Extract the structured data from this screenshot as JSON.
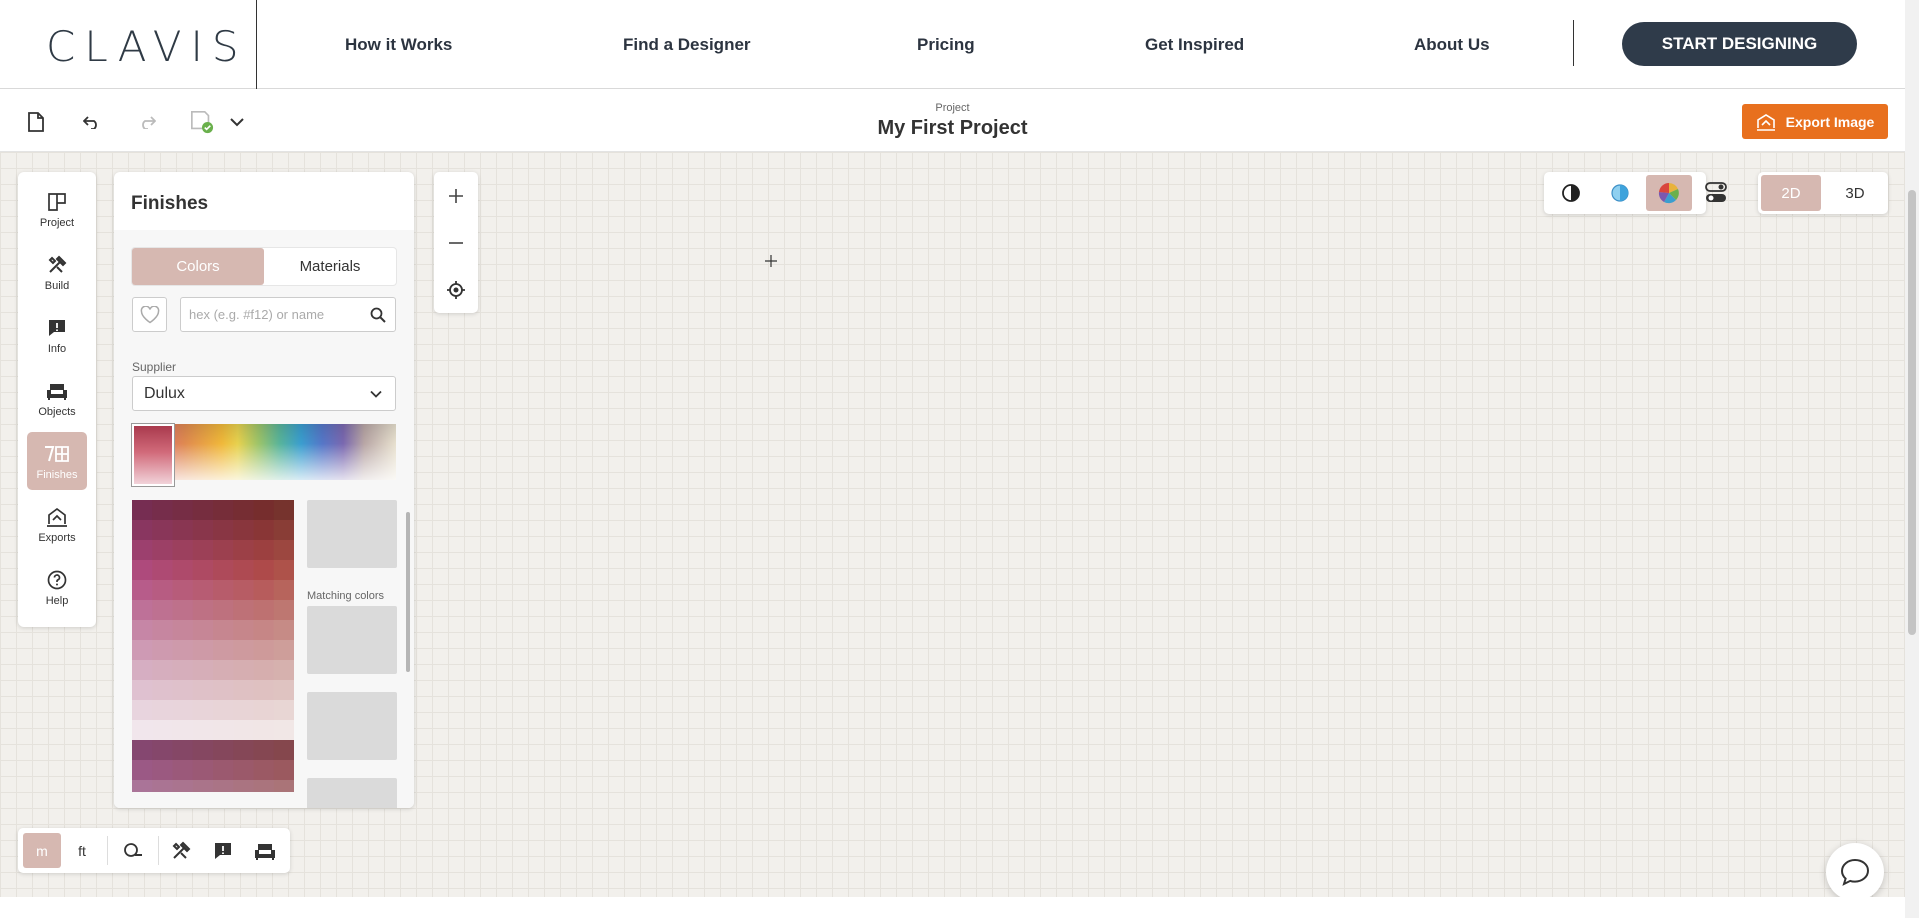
{
  "header": {
    "logo": "CLAVIS",
    "nav": [
      "How it Works",
      "Find a Designer",
      "Pricing",
      "Get Inspired",
      "About Us"
    ],
    "cta": "START DESIGNING"
  },
  "toolbar": {
    "project_label": "Project",
    "project_title": "My First Project",
    "export_label": "Export Image"
  },
  "rail": {
    "items": [
      {
        "label": "Project",
        "icon": "project-icon"
      },
      {
        "label": "Build",
        "icon": "build-icon"
      },
      {
        "label": "Info",
        "icon": "info-icon"
      },
      {
        "label": "Objects",
        "icon": "sofa-icon"
      },
      {
        "label": "Finishes",
        "icon": "finishes-icon",
        "active": true
      },
      {
        "label": "Exports",
        "icon": "exports-icon"
      },
      {
        "label": "Help",
        "icon": "help-icon"
      }
    ]
  },
  "finishes": {
    "title": "Finishes",
    "tabs": [
      "Colors",
      "Materials"
    ],
    "active_tab": "Colors",
    "search_placeholder": "hex (e.g. #f12) or name",
    "search_value": "",
    "supplier_label": "Supplier",
    "supplier_value": "Dulux",
    "matching_label": "Matching colors"
  },
  "view": {
    "dimension_modes": [
      "2D",
      "3D"
    ],
    "active_dimension": "2D",
    "active_render_mode": "color-wheel-icon"
  },
  "bottom_toolbar": {
    "units": [
      "m",
      "ft"
    ],
    "active_unit": "m"
  },
  "colors": {
    "accent": "#d6b8b1",
    "cta": "#2f3b4a",
    "export": "#e8701e"
  }
}
